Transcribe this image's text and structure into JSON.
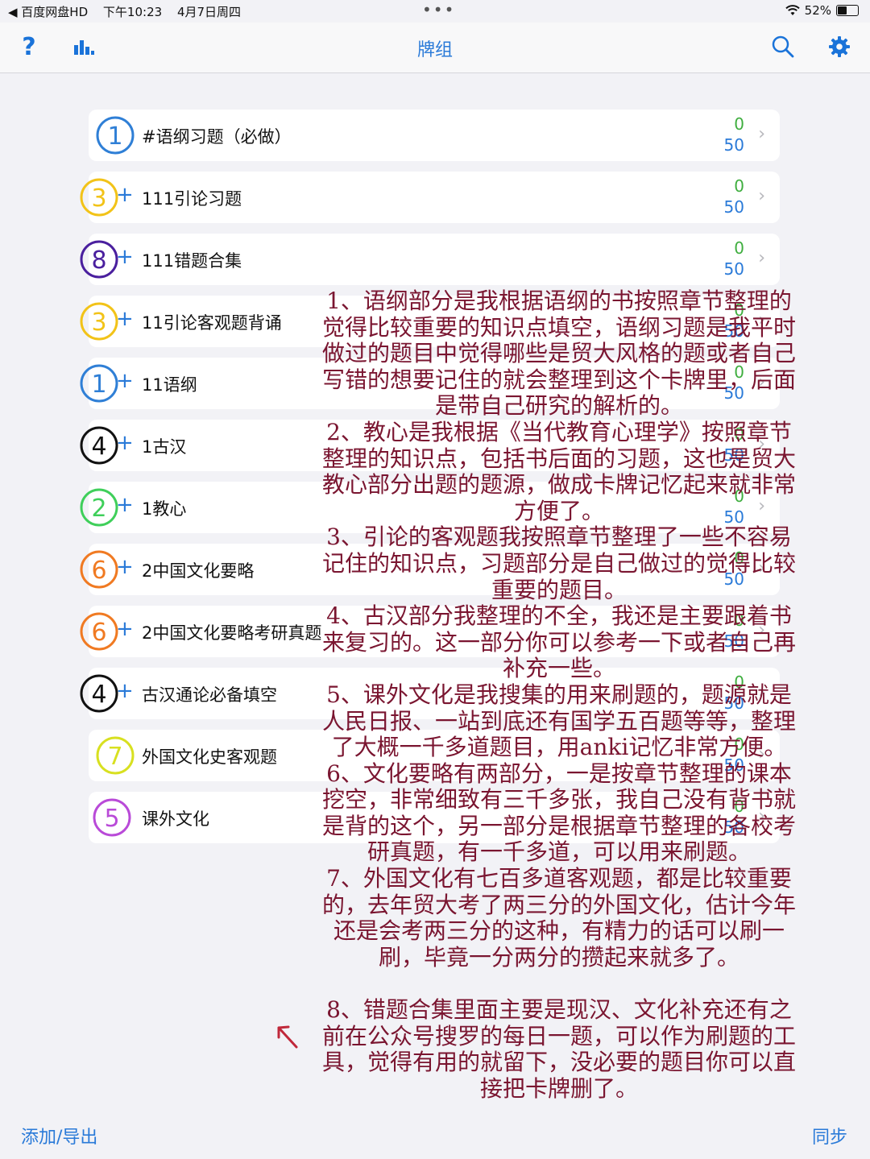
{
  "status_bar": {
    "back_app": "◀ 百度网盘HD",
    "time": "下午10:23",
    "date": "4月7日周四",
    "battery": "52%",
    "battery_level": 0.52
  },
  "nav": {
    "title": "牌组",
    "help_icon": "question-mark-icon",
    "stats_icon": "bar-chart-icon",
    "search_icon": "search-icon",
    "settings_icon": "gear-icon"
  },
  "decks": [
    {
      "name": "#语纲习题（必做）",
      "due": "0",
      "new": "50",
      "mark": "1",
      "mark_color": "#2f7fd6",
      "has_plus": false
    },
    {
      "name": "111引论习题",
      "due": "0",
      "new": "50",
      "mark": "3",
      "mark_color": "#f2c318",
      "has_plus": true
    },
    {
      "name": "111错题合集",
      "due": "0",
      "new": "50",
      "mark": "8",
      "mark_color": "#4a1f9e",
      "has_plus": true
    },
    {
      "name": "11引论客观题背诵",
      "due": "0",
      "new": "50",
      "mark": "3",
      "mark_color": "#f2c318",
      "has_plus": true
    },
    {
      "name": "11语纲",
      "due": "0",
      "new": "50",
      "mark": "1",
      "mark_color": "#2f7fd6",
      "has_plus": true
    },
    {
      "name": "1古汉",
      "due": "0",
      "new": "50",
      "mark": "4",
      "mark_color": "#111111",
      "has_plus": true
    },
    {
      "name": "1教心",
      "due": "0",
      "new": "50",
      "mark": "2",
      "mark_color": "#3fcf5a",
      "has_plus": true
    },
    {
      "name": "2中国文化要略",
      "due": "0",
      "new": "50",
      "mark": "6",
      "mark_color": "#f07a22",
      "has_plus": true
    },
    {
      "name": "2中国文化要略考研真题",
      "due": "0",
      "new": "50",
      "mark": "6",
      "mark_color": "#f07a22",
      "has_plus": true
    },
    {
      "name": "古汉通论必备填空",
      "due": "0",
      "new": "50",
      "mark": "4",
      "mark_color": "#111111",
      "has_plus": true
    },
    {
      "name": "外国文化史客观题",
      "due": "0",
      "new": "50",
      "mark": "7",
      "mark_color": "#d8e020",
      "has_plus": false
    },
    {
      "name": "课外文化",
      "due": "0",
      "new": "50",
      "mark": "5",
      "mark_color": "#b94ad8",
      "has_plus": false
    }
  ],
  "annotation": {
    "text": "1、语纲部分是我根据语纲的书按照章节整理的觉得比较重要的知识点填空，语纲习题是我平时做过的题目中觉得哪些是贸大风格的题或者自己写错的想要记住的就会整理到这个卡牌里，后面是带自己研究的解析的。\n2、教心是我根据《当代教育心理学》按照章节整理的知识点，包括书后面的习题，这也是贸大教心部分出题的题源，做成卡牌记忆起来就非常方便了。\n3、引论的客观题我按照章节整理了一些不容易记住的知识点，习题部分是自己做过的觉得比较重要的题目。\n4、古汉部分我整理的不全，我还是主要跟着书来复习的。这一部分你可以参考一下或者自己再补充一些。\n5、课外文化是我搜集的用来刷题的，题源就是人民日报、一站到底还有国学五百题等等，整理了大概一千多道题目，用anki记忆非常方便。\n6、文化要略有两部分，一是按章节整理的课本挖空，非常细致有三千多张，我自己没有背书就是背的这个，另一部分是根据章节整理的各校考研真题，有一千多道，可以用来刷题。\n7、外国文化有七百多道客观题，都是比较重要的，去年贸大考了两三分的外国文化，估计今年还是会考两三分的这种，有精力的话可以刷一刷，毕竟一分两分的攒起来就多了。\n\n8、错题合集里面主要是现汉、文化补充还有之前在公众号搜罗的每日一题，可以作为刷题的工具，觉得有用的就留下，没必要的题目你可以直接把卡牌删了。",
    "color": "#7a1530"
  },
  "bottom": {
    "add_export": "添加/导出",
    "sync": "同步"
  }
}
